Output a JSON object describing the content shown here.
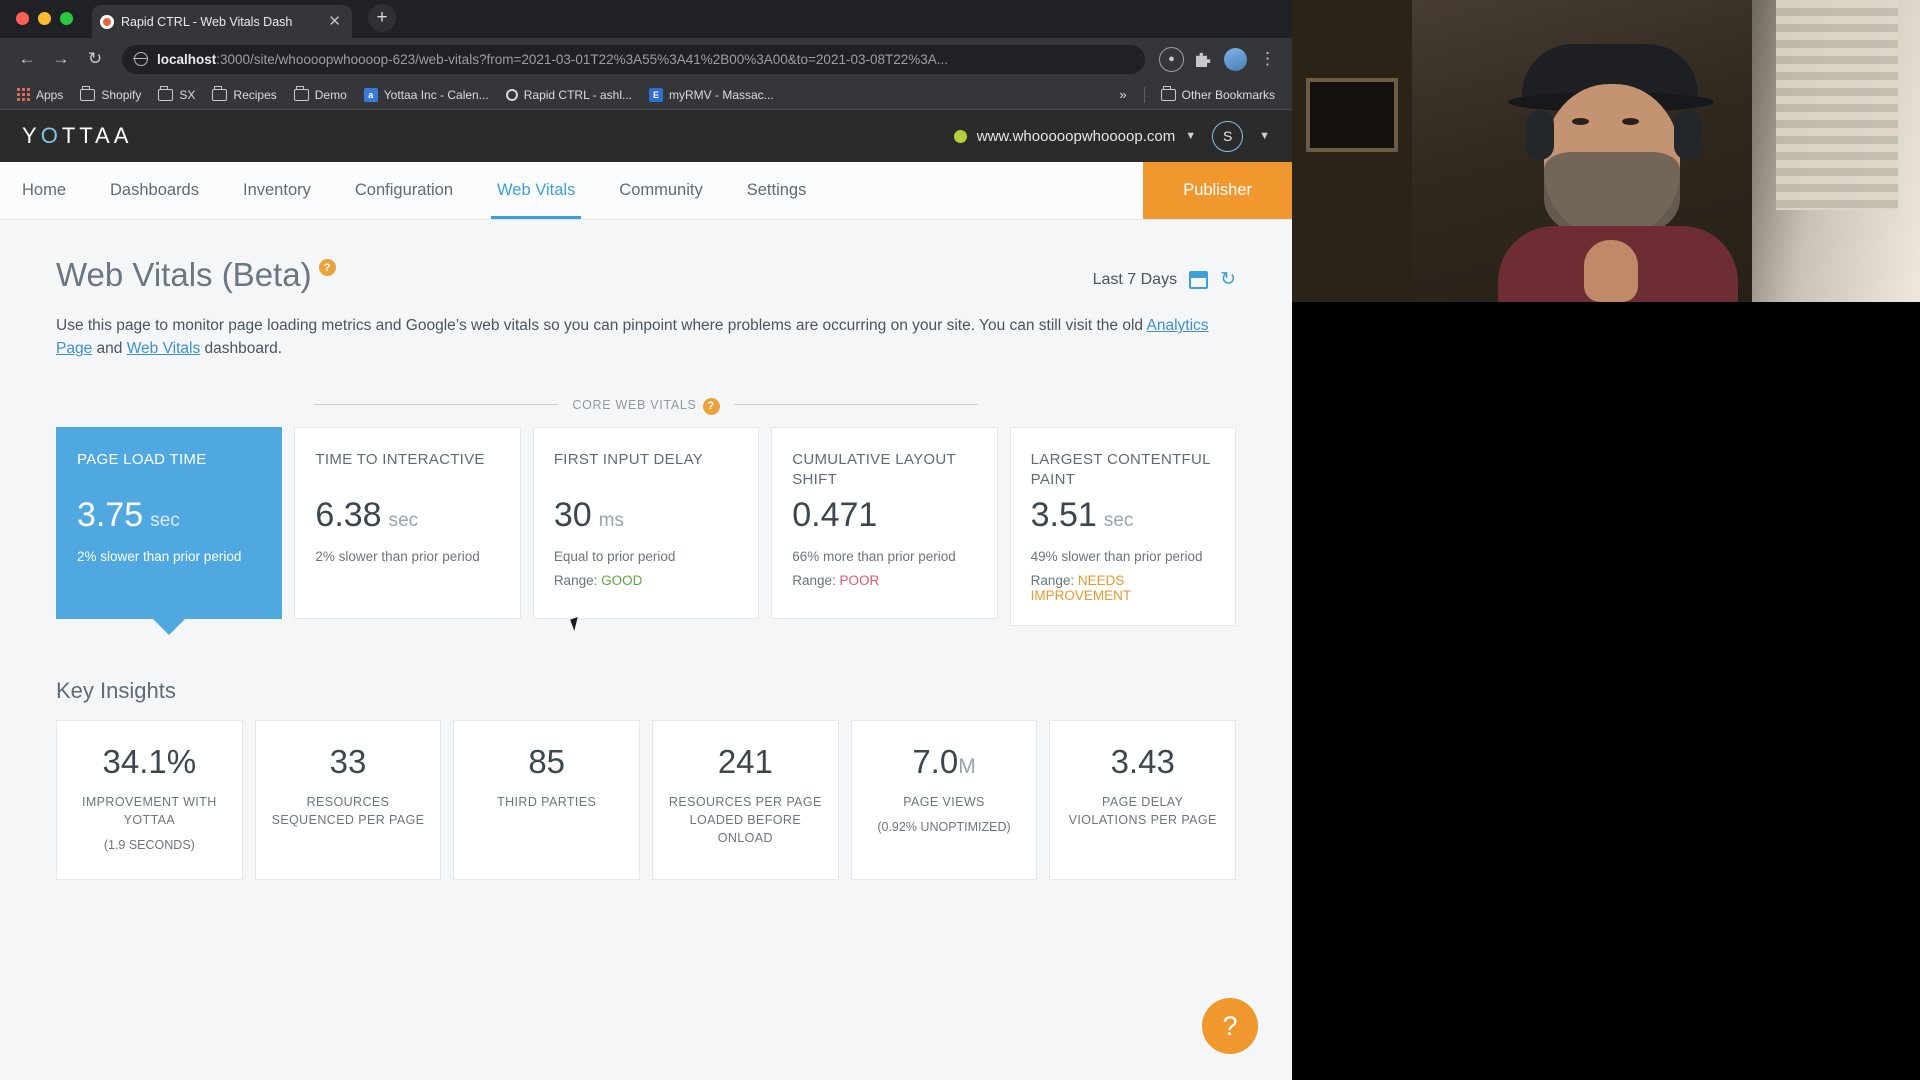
{
  "browser": {
    "tab": {
      "title": "Rapid CTRL - Web Vitals Dash",
      "close_icon": "close-icon",
      "favicon": "site-favicon"
    },
    "new_tab_label": "+",
    "nav": {
      "back": "←",
      "forward": "→",
      "reload": "↻"
    },
    "omnibox": {
      "host": "localhost",
      "path": ":3000/site/whoooopwhoooop-623/web-vitals?from=2021-03-01T22%3A55%3A41%2B00%3A00&to=2021-03-08T22%3A..."
    },
    "bookmarks": [
      {
        "label": "Apps",
        "icon": "apps-grid-icon"
      },
      {
        "label": "Shopify",
        "icon": "folder-icon"
      },
      {
        "label": "SX",
        "icon": "folder-icon"
      },
      {
        "label": "Recipes",
        "icon": "folder-icon"
      },
      {
        "label": "Demo",
        "icon": "folder-icon"
      },
      {
        "label": "Yottaa Inc - Calen...",
        "icon": "calendar-favicon"
      },
      {
        "label": "Rapid CTRL - ashl...",
        "icon": "ring-favicon"
      },
      {
        "label": "myRMV - Massac...",
        "icon": "e-favicon"
      }
    ],
    "bookmarks_overflow": "»",
    "other_bookmarks": "Other Bookmarks"
  },
  "app": {
    "logo": {
      "pre": "Y",
      "accent": "O",
      "post": "TTAA"
    },
    "site_selector": {
      "domain": "www.whooooopwhoooop.com",
      "status_color": "#b5cf3a",
      "chevron": "▼"
    },
    "user_initial": "S",
    "user_chevron": "▼"
  },
  "nav": {
    "items": [
      {
        "label": "Home",
        "active": false
      },
      {
        "label": "Dashboards",
        "active": false
      },
      {
        "label": "Inventory",
        "active": false
      },
      {
        "label": "Configuration",
        "active": false
      },
      {
        "label": "Web Vitals",
        "active": true
      },
      {
        "label": "Community",
        "active": false
      },
      {
        "label": "Settings",
        "active": false
      }
    ],
    "publisher_label": "Publisher"
  },
  "page": {
    "title": "Web Vitals (Beta)",
    "help_icon": "?",
    "date_range": "Last 7 Days",
    "description_part1": "Use this page to monitor page loading metrics and Google’s web vitals so you can pinpoint where problems are occurring on your site. You can still visit the old ",
    "link_analytics": "Analytics Page",
    "description_and": " and ",
    "link_webvitals": "Web Vitals",
    "description_part2": " dashboard."
  },
  "core_web_vitals": {
    "band_label": "CORE WEB VITALS",
    "cards": [
      {
        "label": "PAGE LOAD TIME",
        "value": "3.75",
        "unit": "sec",
        "subtext": "2% slower than prior period",
        "range_label": "",
        "range_value": "",
        "selected": true
      },
      {
        "label": "TIME TO INTERACTIVE",
        "value": "6.38",
        "unit": "sec",
        "subtext": "2% slower than prior period",
        "range_label": "",
        "range_value": "",
        "selected": false
      },
      {
        "label": "FIRST INPUT DELAY",
        "value": "30",
        "unit": "ms",
        "subtext": "Equal to prior period",
        "range_label": "Range: ",
        "range_value": "GOOD",
        "range_class": "r-good",
        "selected": false
      },
      {
        "label": "CUMULATIVE LAYOUT SHIFT",
        "value": "0.471",
        "unit": "",
        "subtext": "66% more than prior period",
        "range_label": "Range: ",
        "range_value": "POOR",
        "range_class": "r-poor",
        "selected": false
      },
      {
        "label": "LARGEST CONTENTFUL PAINT",
        "value": "3.51",
        "unit": "sec",
        "subtext": "49% slower than prior period",
        "range_label": "Range: ",
        "range_value": "NEEDS IMPROVEMENT",
        "range_class": "r-ni",
        "selected": false
      }
    ]
  },
  "key_insights": {
    "title": "Key Insights",
    "cards": [
      {
        "value": "34.1%",
        "suffix": "",
        "label": "IMPROVEMENT WITH YOTTAA",
        "note": "(1.9 SECONDS)"
      },
      {
        "value": "33",
        "suffix": "",
        "label": "RESOURCES SEQUENCED PER PAGE",
        "note": ""
      },
      {
        "value": "85",
        "suffix": "",
        "label": "THIRD PARTIES",
        "note": ""
      },
      {
        "value": "241",
        "suffix": "",
        "label": "RESOURCES PER PAGE LOADED BEFORE ONLOAD",
        "note": ""
      },
      {
        "value": "7.0",
        "suffix": "M",
        "label": "PAGE VIEWS",
        "note": "(0.92% UNOPTIMIZED)"
      },
      {
        "value": "3.43",
        "suffix": "",
        "label": "PAGE DELAY VIOLATIONS PER PAGE",
        "note": ""
      }
    ]
  },
  "help_fab": "?",
  "colors": {
    "accent_blue": "#4fa9e0",
    "orange": "#f0982d",
    "good": "#5fa83e",
    "poor": "#e4566e",
    "needs_improvement": "#e89a2c"
  }
}
